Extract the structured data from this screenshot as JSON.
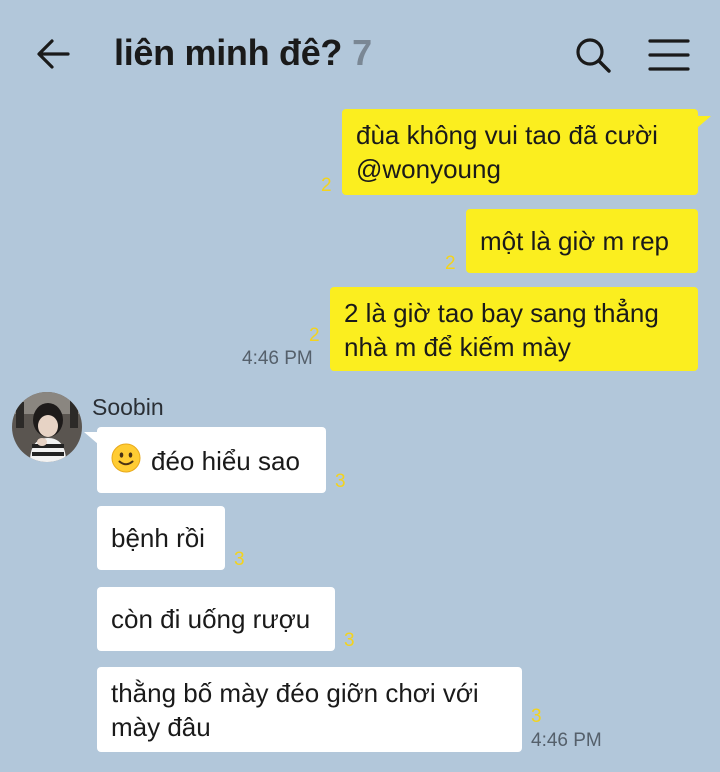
{
  "header": {
    "title": "liên minh đê?",
    "member_count": "7",
    "back_icon": "arrow-left-icon",
    "search_icon": "search-icon",
    "menu_icon": "hamburger-menu-icon"
  },
  "messages_out": [
    {
      "text_lines": [
        "đùa không vui tao đã cười",
        "@wonyoung"
      ],
      "unread": "2"
    },
    {
      "text_lines": [
        "một là giờ m rep"
      ],
      "unread": "2"
    },
    {
      "text_lines": [
        "2 là giờ tao bay sang thẳng",
        "nhà m để kiếm mày"
      ],
      "unread": "2",
      "time": "4:46 PM"
    }
  ],
  "sender": {
    "name": "Soobin",
    "avatar_icon": "avatar-photo"
  },
  "messages_in": [
    {
      "emoji": "slightly-smiling-face-icon",
      "text_lines": [
        "đéo hiểu sao"
      ],
      "unread": "3"
    },
    {
      "text_lines": [
        "bệnh rồi"
      ],
      "unread": "3"
    },
    {
      "text_lines": [
        "còn đi uống rượu"
      ],
      "unread": "3"
    },
    {
      "text_lines": [
        "thằng bố mày đéo giỡn chơi với",
        "mày đâu"
      ],
      "unread": "3",
      "time": "4:46 PM"
    }
  ],
  "colors": {
    "background": "#b2c7da",
    "my_bubble": "#fbee1f",
    "their_bubble": "#ffffff",
    "unread_count": "#f3d31e"
  }
}
